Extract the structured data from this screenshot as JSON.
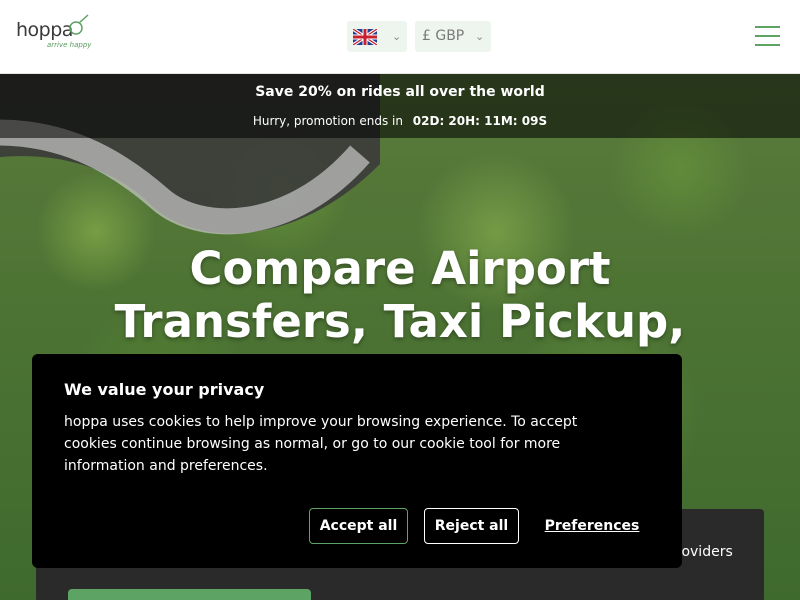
{
  "header": {
    "logo": {
      "name": "hoppa",
      "tagline": "arrive happy"
    },
    "language": {
      "flag": "uk-flag-icon"
    },
    "currency": {
      "label": "£ GBP"
    },
    "menu_icon": "hamburger-menu-icon"
  },
  "promo": {
    "title": "Save 20% on rides all over the world",
    "subtitle": "Hurry, promotion ends in",
    "countdown": "02D: 20H: 11M: 09S"
  },
  "hero": {
    "title_line1": "Compare Airport",
    "title_line2": "Transfers, Taxi Pickup,"
  },
  "search_panel": {
    "visible_text": "roviders"
  },
  "cookie": {
    "title": "We value your privacy",
    "body": "hoppa uses cookies to help improve your browsing experience. To accept cookies continue browsing as normal, or go to our cookie tool for more information and preferences.",
    "accept_label": "Accept all",
    "reject_label": "Reject all",
    "preferences_label": "Preferences"
  },
  "colors": {
    "brand_green": "#5da363",
    "dialog_bg": "#000000",
    "panel_bg": "#2a2a2a"
  }
}
